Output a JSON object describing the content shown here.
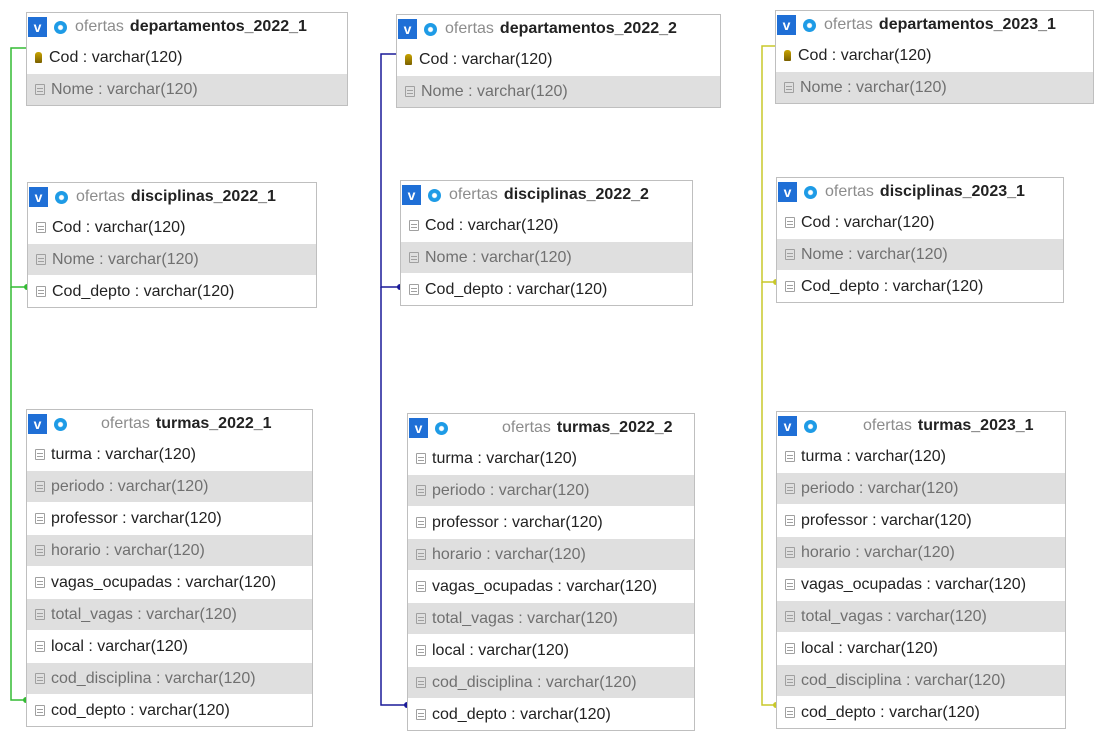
{
  "colors": {
    "connector_2022_1": "#33bb33",
    "connector_2022_2": "#1a1a99",
    "connector_2023_1": "#c8c82a"
  },
  "tables": [
    {
      "schema": "ofertas",
      "name": "departamentos_2022_1",
      "columns": [
        {
          "label": "Cod : varchar(120)",
          "key": true
        },
        {
          "label": "Nome : varchar(120)",
          "key": false
        }
      ]
    },
    {
      "schema": "ofertas",
      "name": "departamentos_2022_2",
      "columns": [
        {
          "label": "Cod : varchar(120)",
          "key": true
        },
        {
          "label": "Nome : varchar(120)",
          "key": false
        }
      ]
    },
    {
      "schema": "ofertas",
      "name": "departamentos_2023_1",
      "columns": [
        {
          "label": "Cod : varchar(120)",
          "key": true
        },
        {
          "label": "Nome : varchar(120)",
          "key": false
        }
      ]
    },
    {
      "schema": "ofertas",
      "name": "disciplinas_2022_1",
      "columns": [
        {
          "label": "Cod : varchar(120)",
          "key": false
        },
        {
          "label": "Nome : varchar(120)",
          "key": false
        },
        {
          "label": "Cod_depto : varchar(120)",
          "key": false
        }
      ]
    },
    {
      "schema": "ofertas",
      "name": "disciplinas_2022_2",
      "columns": [
        {
          "label": "Cod : varchar(120)",
          "key": false
        },
        {
          "label": "Nome : varchar(120)",
          "key": false
        },
        {
          "label": "Cod_depto : varchar(120)",
          "key": false
        }
      ]
    },
    {
      "schema": "ofertas",
      "name": "disciplinas_2023_1",
      "columns": [
        {
          "label": "Cod : varchar(120)",
          "key": false
        },
        {
          "label": "Nome : varchar(120)",
          "key": false
        },
        {
          "label": "Cod_depto : varchar(120)",
          "key": false
        }
      ]
    },
    {
      "schema": "ofertas",
      "name": "turmas_2022_1",
      "columns": [
        {
          "label": "turma : varchar(120)",
          "key": false
        },
        {
          "label": "periodo : varchar(120)",
          "key": false
        },
        {
          "label": "professor : varchar(120)",
          "key": false
        },
        {
          "label": "horario : varchar(120)",
          "key": false
        },
        {
          "label": "vagas_ocupadas : varchar(120)",
          "key": false
        },
        {
          "label": "total_vagas : varchar(120)",
          "key": false
        },
        {
          "label": "local : varchar(120)",
          "key": false
        },
        {
          "label": "cod_disciplina : varchar(120)",
          "key": false
        },
        {
          "label": "cod_depto : varchar(120)",
          "key": false
        }
      ]
    },
    {
      "schema": "ofertas",
      "name": "turmas_2022_2",
      "columns": [
        {
          "label": "turma : varchar(120)",
          "key": false
        },
        {
          "label": "periodo : varchar(120)",
          "key": false
        },
        {
          "label": "professor : varchar(120)",
          "key": false
        },
        {
          "label": "horario : varchar(120)",
          "key": false
        },
        {
          "label": "vagas_ocupadas : varchar(120)",
          "key": false
        },
        {
          "label": "total_vagas : varchar(120)",
          "key": false
        },
        {
          "label": "local : varchar(120)",
          "key": false
        },
        {
          "label": "cod_disciplina : varchar(120)",
          "key": false
        },
        {
          "label": "cod_depto : varchar(120)",
          "key": false
        }
      ]
    },
    {
      "schema": "ofertas",
      "name": "turmas_2023_1",
      "columns": [
        {
          "label": "turma : varchar(120)",
          "key": false
        },
        {
          "label": "periodo : varchar(120)",
          "key": false
        },
        {
          "label": "professor : varchar(120)",
          "key": false
        },
        {
          "label": "horario : varchar(120)",
          "key": false
        },
        {
          "label": "vagas_ocupadas : varchar(120)",
          "key": false
        },
        {
          "label": "total_vagas : varchar(120)",
          "key": false
        },
        {
          "label": "local : varchar(120)",
          "key": false
        },
        {
          "label": "cod_disciplina : varchar(120)",
          "key": false
        },
        {
          "label": "cod_depto : varchar(120)",
          "key": false
        }
      ]
    }
  ]
}
